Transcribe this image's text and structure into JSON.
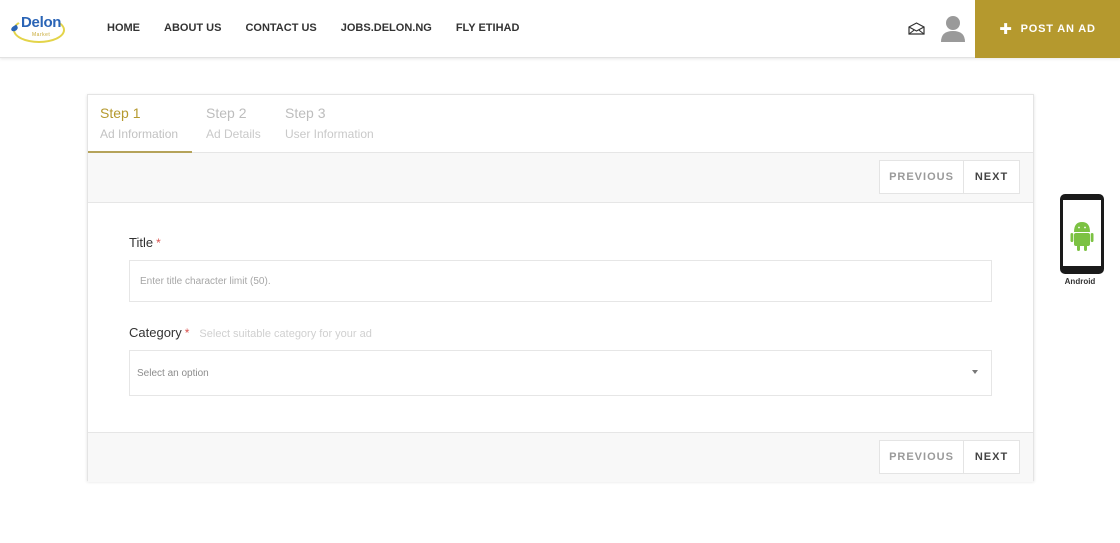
{
  "header": {
    "logo": {
      "word": "Delon",
      "sub": "Market"
    },
    "nav": [
      "HOME",
      "ABOUT US",
      "CONTACT US",
      "JOBS.DELON.NG",
      "FLY ETIHAD"
    ],
    "post_ad": {
      "icon": "plus-icon",
      "label": "POST AN AD"
    },
    "icons": {
      "mail": "mail-open-icon",
      "user": "user-avatar-icon"
    }
  },
  "wizard": {
    "steps": [
      {
        "num": "Step 1",
        "label": "Ad Information",
        "active": true
      },
      {
        "num": "Step 2",
        "label": "Ad Details",
        "active": false
      },
      {
        "num": "Step 3",
        "label": "User Information",
        "active": false
      }
    ],
    "buttons": {
      "previous": "PREVIOUS",
      "next": "NEXT"
    }
  },
  "form": {
    "title": {
      "label": "Title",
      "required": "*",
      "placeholder": "Enter title  character limit (50)."
    },
    "category": {
      "label": "Category",
      "required": "*",
      "hint": "Select suitable category for your ad",
      "selected": "Select an option"
    }
  },
  "android": {
    "label": "Android"
  },
  "colors": {
    "accent": "#b5992e",
    "required": "#d9534f",
    "android_green": "#7cc243"
  }
}
